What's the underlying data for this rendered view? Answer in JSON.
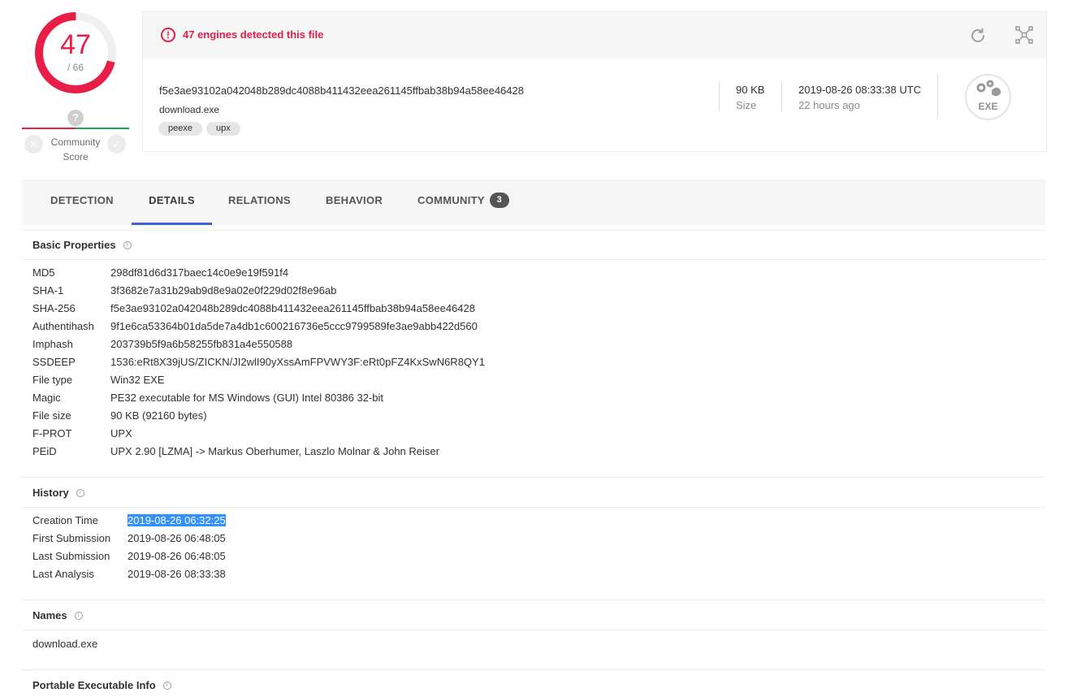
{
  "score": {
    "detected": "47",
    "total": "/ 66",
    "fraction": 0.712
  },
  "community": {
    "label_line1": "Community",
    "label_line2": "Score",
    "unknown_mark": "?",
    "down_glyph": "✕",
    "up_glyph": "✓"
  },
  "alert": {
    "icon_glyph": "!",
    "text": "47 engines detected this file"
  },
  "file": {
    "sha256": "f5e3ae93102a042048b289dc4088b411432eea261145ffbab38b94a58ee46428",
    "name": "download.exe",
    "tags": [
      "peexe",
      "upx"
    ],
    "size_value": "90 KB",
    "size_label": "Size",
    "date_value": "2019-08-26 08:33:38 UTC",
    "date_label": "22 hours ago",
    "type_label": "EXE"
  },
  "icons": {
    "reanalyze": "reanalyze-icon",
    "graph": "graph-icon",
    "alert": "alert-icon",
    "info": "info-icon",
    "filetype": "gears-icon"
  },
  "tabs": [
    {
      "label": "DETECTION"
    },
    {
      "label": "DETAILS",
      "active": true
    },
    {
      "label": "RELATIONS"
    },
    {
      "label": "BEHAVIOR"
    },
    {
      "label": "COMMUNITY",
      "badge": "3"
    }
  ],
  "basic_properties": {
    "title": "Basic Properties",
    "rows": [
      {
        "key": "MD5",
        "value": "298df81d6d317baec14c0e9e19f591f4"
      },
      {
        "key": "SHA-1",
        "value": "3f3682e7a31b29ab9d8e9a02e0f229d02f8e96ab"
      },
      {
        "key": "SHA-256",
        "value": "f5e3ae93102a042048b289dc4088b411432eea261145ffbab38b94a58ee46428"
      },
      {
        "key": "Authentihash",
        "value": "9f1e6ca53364b01da5de7a4db1c600216736e5ccc9799589fe3ae9abb422d560"
      },
      {
        "key": "Imphash",
        "value": "203739b5f9a6b58255fb831a4e550588"
      },
      {
        "key": "SSDEEP",
        "value": "1536:eRt8X39jUS/ZICKN/JI2wlI90yXssAmFPVWY3F:eRt0pFZ4KxSwN6R8QY1"
      },
      {
        "key": "File type",
        "value": "Win32 EXE"
      },
      {
        "key": "Magic",
        "value": "PE32 executable for MS Windows (GUI) Intel 80386 32-bit"
      },
      {
        "key": "File size",
        "value": "90 KB (92160 bytes)"
      },
      {
        "key": "F-PROT",
        "value": "UPX"
      },
      {
        "key": "PEiD",
        "value": "UPX 2.90 [LZMA] -> Markus Oberhumer, Laszlo Molnar & John Reiser"
      }
    ]
  },
  "history": {
    "title": "History",
    "rows": [
      {
        "key": "Creation Time",
        "value": "2019-08-26 06:32:25",
        "selected": true
      },
      {
        "key": "First Submission",
        "value": "2019-08-26 06:48:05"
      },
      {
        "key": "Last Submission",
        "value": "2019-08-26 06:48:05"
      },
      {
        "key": "Last Analysis",
        "value": "2019-08-26 08:33:38"
      }
    ]
  },
  "names": {
    "title": "Names",
    "items": [
      "download.exe"
    ]
  },
  "pe_info": {
    "title": "Portable Executable Info"
  },
  "colors": {
    "danger": "#e91e46",
    "accent": "#3c64d8",
    "good": "#20a35b",
    "selection": "#3390ff"
  }
}
